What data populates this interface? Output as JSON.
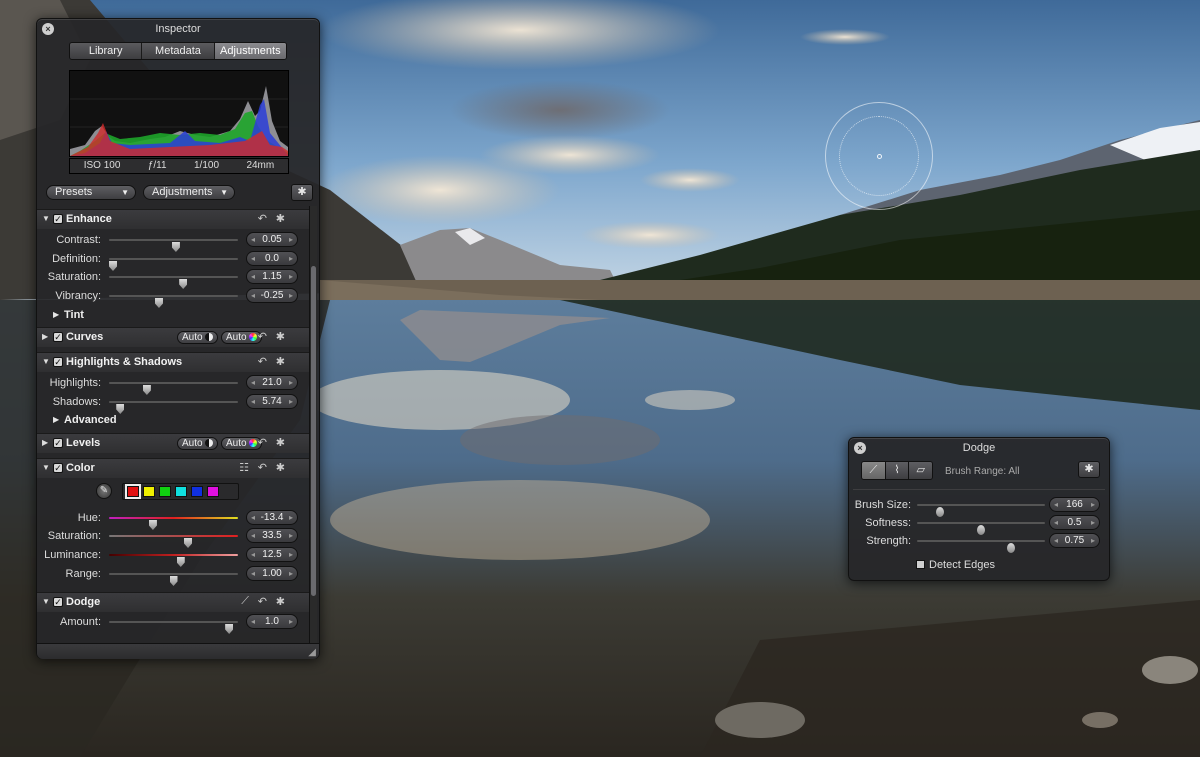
{
  "inspector": {
    "title": "Inspector",
    "tabs": [
      "Library",
      "Metadata",
      "Adjustments"
    ],
    "active_tab": "Adjustments",
    "exif": {
      "iso": "ISO 100",
      "aperture": "ƒ/11",
      "shutter": "1/100",
      "focal": "24mm"
    },
    "presets_label": "Presets",
    "adjustments_label": "Adjustments",
    "enhance": {
      "title": "Enhance",
      "rows": [
        {
          "label": "Contrast:",
          "value": "0.05",
          "pos": 0.52
        },
        {
          "label": "Definition:",
          "value": "0.0",
          "pos": 0.0
        },
        {
          "label": "Saturation:",
          "value": "1.15",
          "pos": 0.58
        },
        {
          "label": "Vibrancy:",
          "value": "-0.25",
          "pos": 0.38
        }
      ],
      "tint_label": "Tint"
    },
    "curves": {
      "title": "Curves",
      "auto1": "Auto",
      "auto2": "Auto"
    },
    "highlights": {
      "title": "Highlights & Shadows",
      "rows": [
        {
          "label": "Highlights:",
          "value": "21.0",
          "pos": 0.28
        },
        {
          "label": "Shadows:",
          "value": "5.74",
          "pos": 0.06
        }
      ],
      "advanced_label": "Advanced"
    },
    "levels": {
      "title": "Levels",
      "auto1": "Auto",
      "auto2": "Auto"
    },
    "color": {
      "title": "Color",
      "swatches": [
        "#e01010",
        "#f0f000",
        "#10d010",
        "#10e0e0",
        "#1030e0",
        "#e010e0"
      ],
      "selected_swatch": 0,
      "rows": [
        {
          "label": "Hue:",
          "value": "-13.4",
          "pos": 0.33
        },
        {
          "label": "Saturation:",
          "value": "33.5",
          "pos": 0.62
        },
        {
          "label": "Luminance:",
          "value": "12.5",
          "pos": 0.56
        },
        {
          "label": "Range:",
          "value": "1.00",
          "pos": 0.5
        }
      ]
    },
    "dodge": {
      "title": "Dodge",
      "rows": [
        {
          "label": "Amount:",
          "value": "1.0",
          "pos": 0.96
        }
      ]
    }
  },
  "dodge_hud": {
    "title": "Dodge",
    "brush_range": "Brush Range: All",
    "rows": [
      {
        "label": "Brush Size:",
        "value": "166",
        "pos": 0.16
      },
      {
        "label": "Softness:",
        "value": "0.5",
        "pos": 0.5
      },
      {
        "label": "Strength:",
        "value": "0.75",
        "pos": 0.75
      }
    ],
    "detect_edges": "Detect Edges",
    "detect_edges_checked": false
  },
  "icons": {
    "close": "close-icon",
    "gear": "gear-icon",
    "undo": "undo-icon",
    "brush": "brush-icon",
    "eyedropper": "eyedropper-icon",
    "feather": "feather-brush-icon",
    "eraser": "eraser-icon"
  }
}
